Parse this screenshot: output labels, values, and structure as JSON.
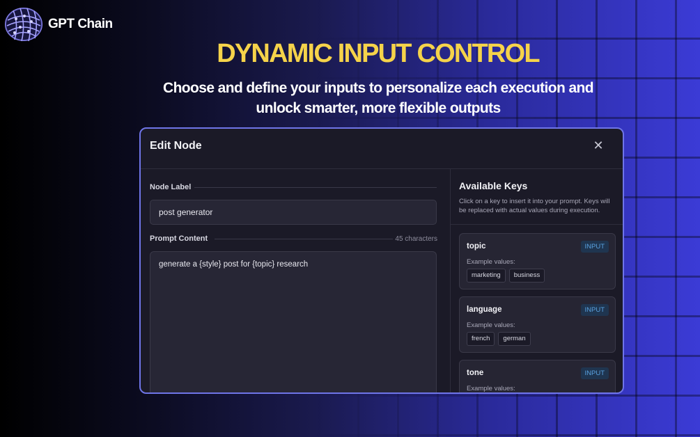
{
  "brand": {
    "name": "GPT Chain",
    "logo_icon": "brain-mesh-icon"
  },
  "hero": {
    "title": "DYNAMIC INPUT CONTROL",
    "subtitle": "Choose and define your inputs to personalize each execution and unlock smarter, more flexible outputs"
  },
  "modal": {
    "title": "Edit Node",
    "close_icon": "close-icon",
    "node_label": {
      "label": "Node Label",
      "value": "post generator"
    },
    "prompt": {
      "label": "Prompt Content",
      "char_count": "45 characters",
      "value": "generate a {style}  post for {topic} research"
    },
    "keys": {
      "title": "Available Keys",
      "description": "Click on a key to insert it into your prompt. Keys will be replaced with actual values during execution.",
      "items": [
        {
          "name": "topic",
          "badge": "INPUT",
          "examples_label": "Example values:",
          "examples": [
            "marketing",
            "business"
          ]
        },
        {
          "name": "language",
          "badge": "INPUT",
          "examples_label": "Example values:",
          "examples": [
            "french",
            "german"
          ]
        },
        {
          "name": "tone",
          "badge": "INPUT",
          "examples_label": "Example values:",
          "examples": []
        }
      ]
    }
  },
  "colors": {
    "accent_yellow": "#f5d34a",
    "modal_border": "#6f75e8",
    "badge_text": "#5aa2e0",
    "panel_bg": "#1b1a27"
  }
}
